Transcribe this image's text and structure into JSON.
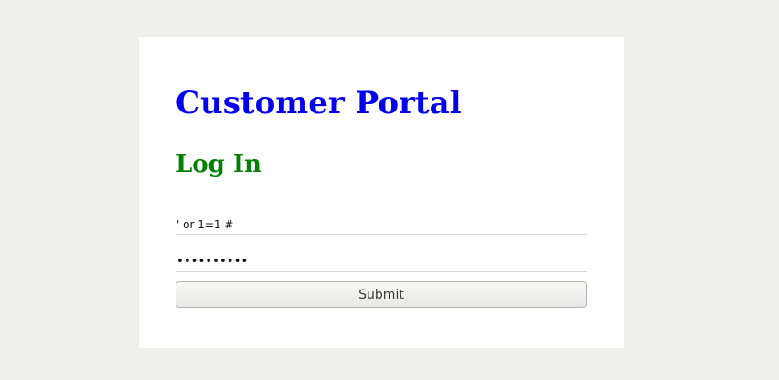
{
  "page": {
    "title": "Customer Portal",
    "subtitle": "Log In"
  },
  "form": {
    "username_value": "' or 1=1 #",
    "password_value": "••••••••••",
    "submit_label": "Submit"
  },
  "colors": {
    "background": "#efefed",
    "card": "#ffffff",
    "title": "#0000ee",
    "subtitle": "#008000",
    "field_underline": "#d6d6d6"
  }
}
